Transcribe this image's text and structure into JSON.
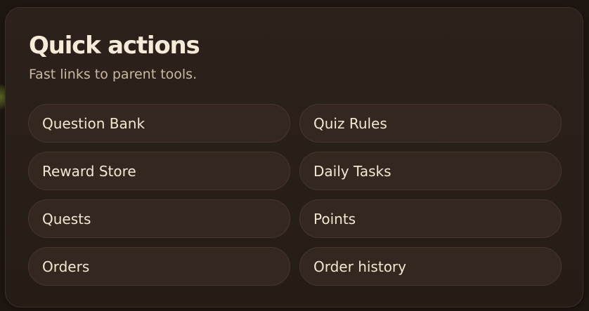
{
  "panel": {
    "title": "Quick actions",
    "subtitle": "Fast links to parent tools."
  },
  "actions": [
    {
      "label": "Question Bank"
    },
    {
      "label": "Quiz Rules"
    },
    {
      "label": "Reward Store"
    },
    {
      "label": "Daily Tasks"
    },
    {
      "label": "Quests"
    },
    {
      "label": "Points"
    },
    {
      "label": "Orders"
    },
    {
      "label": "Order history"
    }
  ],
  "colors": {
    "background": "#1e1611",
    "card": "#2a1f19",
    "button": "#34271f",
    "title": "#f6ead8",
    "subtitle": "#c9b8a4"
  }
}
